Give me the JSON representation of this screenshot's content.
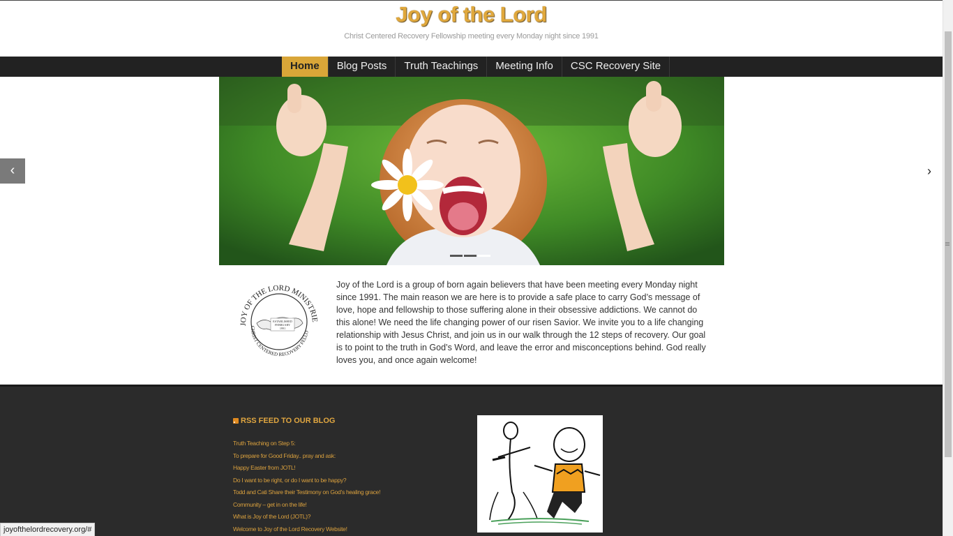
{
  "header": {
    "title": "Joy of the Lord",
    "tagline": "Christ Centered Recovery Fellowship meeting every Monday night since 1991"
  },
  "nav": {
    "items": [
      {
        "label": "Home",
        "active": true
      },
      {
        "label": "Blog Posts",
        "active": false
      },
      {
        "label": "Truth Teachings",
        "active": false
      },
      {
        "label": "Meeting Info",
        "active": false
      },
      {
        "label": "CSC Recovery Site",
        "active": false
      }
    ]
  },
  "slider": {
    "prev_icon": "chevron-left-icon",
    "next_icon": "chevron-right-icon",
    "slide_count": 3,
    "active_slide": 3
  },
  "intro": {
    "logo": {
      "ring_text": "JOY OF THE LORD MINISTRIES",
      "ring_text_bottom": "CHRIST CENTERED RECOVERY FELLOWSHIP",
      "established": "ESTABLISHED",
      "month": "FEBRUARY",
      "year": "1991"
    },
    "text": "Joy of the Lord is a group of born again believers that have been meeting every Monday night since 1991. The main reason we are here is to provide a safe place to carry God’s message of love, hope and fellowship to those suffering alone in their obsessive addictions. We cannot do this alone! We need the life changing power of our risen Savior. We invite you to a life changing relationship with Jesus Christ, and join us in our walk through the 12 steps of recovery. Our goal is to point to the truth in God’s Word, and leave the error and misconceptions behind. God really loves you, and once again welcome!"
  },
  "footer": {
    "rss_heading": "RSS FEED TO OUR BLOG",
    "rss_items": [
      "Truth Teaching on Step 5:",
      "To prepare for Good Friday.. pray and ask:",
      "Happy Easter from JOTL!",
      "Do I want to be right, or do I want to be happy?",
      "Todd and Cati Share their Testimony on God’s healing grace!",
      "Community – get in on the life!",
      "What is Joy of the Lord (JOTL)?",
      "Welcome to Joy of the Lord Recovery Website!"
    ]
  },
  "status_bar": {
    "url": "joyofthelordrecovery.org/#"
  },
  "colors": {
    "accent": "#d9a638",
    "nav_bg": "#222222",
    "footer_bg": "#2b2b2b"
  }
}
